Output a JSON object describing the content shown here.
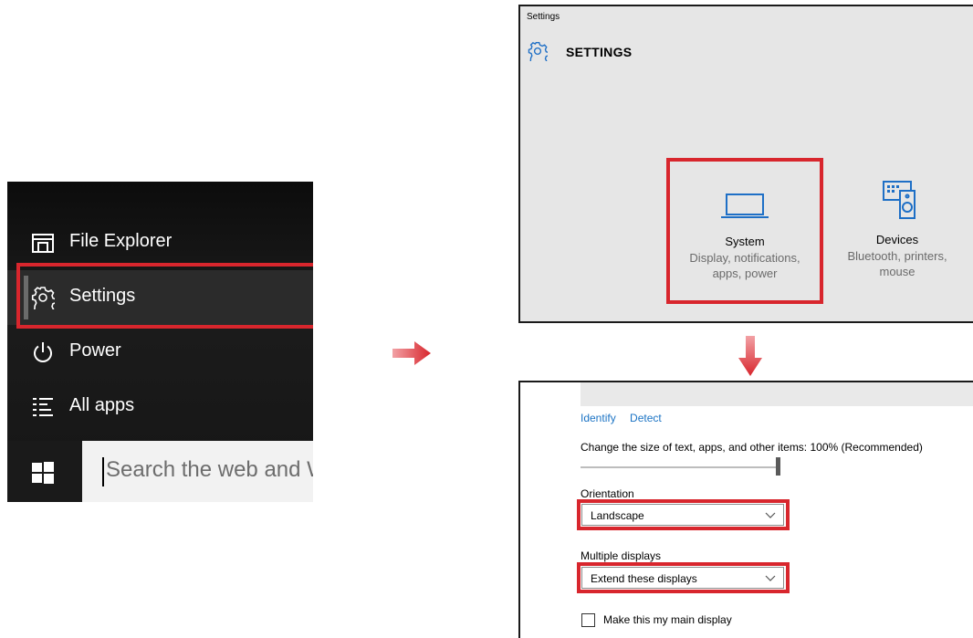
{
  "start_menu": {
    "items": [
      {
        "label": "File Explorer",
        "icon": "file-explorer-icon"
      },
      {
        "label": "Settings",
        "icon": "gear-icon"
      },
      {
        "label": "Power",
        "icon": "power-icon"
      },
      {
        "label": "All apps",
        "icon": "all-apps-icon"
      }
    ],
    "search_placeholder": "Search the web and W"
  },
  "settings_window": {
    "title": "Settings",
    "heading": "SETTINGS",
    "tiles": [
      {
        "name": "System",
        "desc_line1": "Display, notifications,",
        "desc_line2": "apps, power",
        "icon": "laptop-icon"
      },
      {
        "name": "Devices",
        "desc_line1": "Bluetooth, printers,",
        "desc_line2": "mouse",
        "icon": "devices-icon"
      }
    ]
  },
  "display_settings": {
    "links": [
      "Identify",
      "Detect"
    ],
    "scale_label": "Change the size of text, apps, and other items: 100% (Recommended)",
    "scale_value_percent": 100,
    "orientation_label": "Orientation",
    "orientation_value": "Landscape",
    "multiple_displays_label": "Multiple displays",
    "multiple_displays_value": "Extend these displays",
    "main_display_checkbox_label": "Make this my main display",
    "main_display_checked": false
  },
  "colors": {
    "highlight_red": "#d8262d",
    "link_blue": "#1b73c4",
    "icon_blue": "#1e6fc6"
  }
}
